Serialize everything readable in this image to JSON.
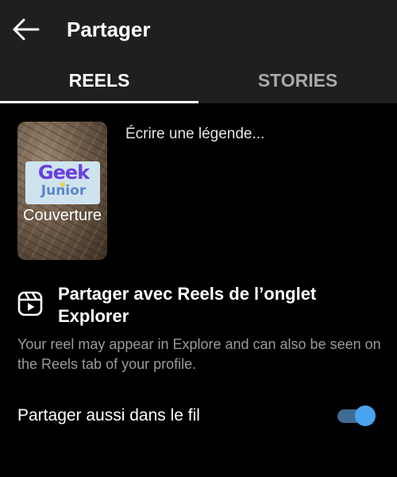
{
  "header": {
    "title": "Partager",
    "back_icon": "arrow-left-icon",
    "background": "#1f1f1f"
  },
  "tabs": [
    {
      "label": "REELS",
      "active": true
    },
    {
      "label": "STORIES",
      "active": false
    }
  ],
  "cover": {
    "label": "Couverture",
    "logo_text_top": "Geek",
    "logo_text_bottom": "Junior"
  },
  "caption": {
    "placeholder": "Écrire une légende..."
  },
  "share_reels": {
    "icon": "reels-icon",
    "title": "Partager avec Reels de l’onglet Explorer",
    "description": "Your reel may appear in Explore and can also be seen on the Reels tab of your profile."
  },
  "share_feed": {
    "label": "Partager aussi dans le fil",
    "enabled": true
  },
  "colors": {
    "background": "#000000",
    "accent": "#4aa3ee",
    "toggle_track": "#3e6c93",
    "muted_text": "#9a9a9a"
  }
}
